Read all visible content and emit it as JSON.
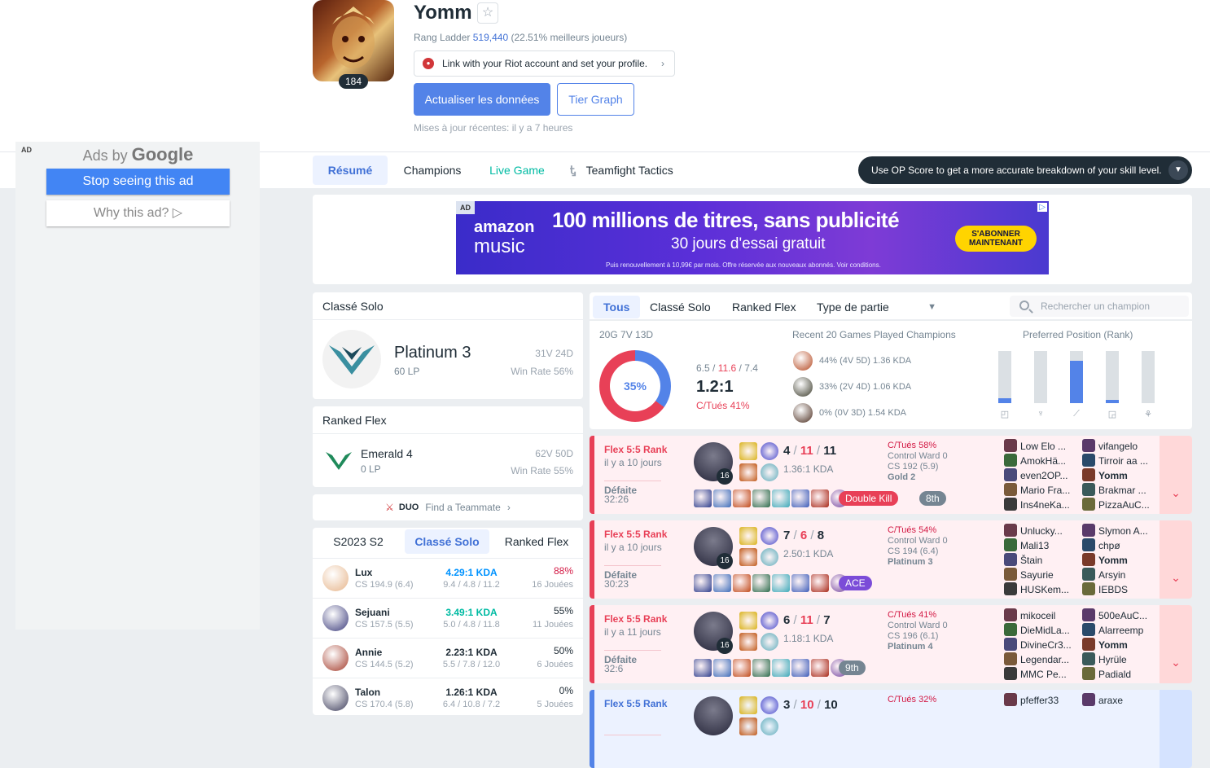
{
  "profile": {
    "name": "Yomm",
    "level": "184",
    "ladder_prefix": "Rang Ladder",
    "ladder_rank": "519,440",
    "ladder_suffix": "(22.51% meilleurs joueurs)",
    "riot_link": "Link with your Riot account and set your profile.",
    "update_button": "Actualiser les données",
    "tier_graph_button": "Tier Graph",
    "last_update": "Mises à jour récentes: il y a 7 heures"
  },
  "google_ad": {
    "label": "AD",
    "ads_by": "Ads by",
    "google": "Google",
    "stop": "Stop seeing this ad",
    "why": "Why this ad? ▷"
  },
  "nav": {
    "tabs": [
      "Résumé",
      "Champions",
      "Live Game",
      "Teamfight Tactics"
    ],
    "op_banner": "Use OP Score to get a more accurate breakdown of your skill level."
  },
  "banner_ad": {
    "label": "AD",
    "brand_top": "amazon",
    "brand_bottom": "music",
    "headline": "100 millions de titres, sans publicité",
    "sub": "30 jours d'essai gratuit",
    "fine": "Puis renouvellement à 10,99€ par mois. Offre réservée aux nouveaux abonnés. Voir conditions.",
    "cta_line1": "S'ABONNER",
    "cta_line2": "MAINTENANT"
  },
  "ranked_solo": {
    "title": "Classé Solo",
    "tier": "Platinum 3",
    "lp": "60 LP",
    "record": "31V 24D",
    "winrate": "Win Rate 56%"
  },
  "ranked_flex": {
    "title": "Ranked Flex",
    "tier": "Emerald 4",
    "lp": "0 LP",
    "record": "62V 50D",
    "winrate": "Win Rate 55%"
  },
  "duo": {
    "tag": "DUO",
    "text": "Find a Teammate"
  },
  "champ_stats": {
    "tabs": [
      "S2023 S2",
      "Classé Solo",
      "Ranked Flex"
    ],
    "rows": [
      {
        "name": "Lux",
        "cs": "CS 194.9 (6.4)",
        "kda": "4.29:1 KDA",
        "kda_detail": "9.4 / 4.8 / 11.2",
        "wr": "88%",
        "games": "16 Jouées",
        "kda_color": "#0093ff",
        "wr_color": "#d31a45",
        "avatar": "#e6b48a"
      },
      {
        "name": "Sejuani",
        "cs": "CS 157.5 (5.5)",
        "kda": "3.49:1 KDA",
        "kda_detail": "5.0 / 4.8 / 11.8",
        "wr": "55%",
        "games": "11 Jouées",
        "kda_color": "#00bba3",
        "wr_color": "#202d37",
        "avatar": "#3a3a7a"
      },
      {
        "name": "Annie",
        "cs": "CS 144.5 (5.2)",
        "kda": "2.23:1 KDA",
        "kda_detail": "5.5 / 7.8 / 12.0",
        "wr": "50%",
        "games": "6 Jouées",
        "kda_color": "#202d37",
        "wr_color": "#202d37",
        "avatar": "#a33a2a"
      },
      {
        "name": "Talon",
        "cs": "CS 170.4 (5.8)",
        "kda": "1.26:1 KDA",
        "kda_detail": "6.4 / 10.8 / 7.2",
        "wr": "0%",
        "games": "5 Jouées",
        "kda_color": "#202d37",
        "wr_color": "#202d37",
        "avatar": "#3c3c5a"
      }
    ]
  },
  "filters": {
    "tabs": [
      "Tous",
      "Classé Solo",
      "Ranked Flex",
      "Type de partie"
    ],
    "search_placeholder": "Rechercher un champion"
  },
  "summary": {
    "record": "20G 7V 13D",
    "winrate": "35%",
    "kda_k": "6.5",
    "kda_d": "11.6",
    "kda_a": "7.4",
    "ratio": "1.2:1",
    "kp": "C/Tués 41%",
    "recent_title": "Recent 20 Games Played Champions",
    "recent": [
      {
        "text": "44% (4V 5D) 1.36 KDA",
        "avatar": "#b4461e"
      },
      {
        "text": "33% (2V 4D) 1.06 KDA",
        "avatar": "#3a3a2a"
      },
      {
        "text": "0% (0V 3D) 1.54 KDA",
        "avatar": "#4a2c1e"
      }
    ],
    "position_title": "Preferred Position (Rank)",
    "positions": [
      {
        "name": "top",
        "fill": 0.1,
        "icon": "top-lane-icon"
      },
      {
        "name": "jungle",
        "fill": 0.0,
        "icon": "jungle-icon"
      },
      {
        "name": "mid",
        "fill": 0.82,
        "icon": "mid-lane-icon"
      },
      {
        "name": "bottom",
        "fill": 0.06,
        "icon": "bot-lane-icon"
      },
      {
        "name": "support",
        "fill": 0.0,
        "icon": "support-icon"
      }
    ]
  },
  "games": [
    {
      "type": "Flex 5:5 Rank",
      "ago": "il y a 10 jours",
      "result": "Défaite",
      "duration": "32:26",
      "level": "16",
      "k": "4",
      "d": "11",
      "a": "11",
      "kda": "1.36:1 KDA",
      "kp": "C/Tués 58%",
      "ward": "Control Ward 0",
      "cs": "CS 192 (5.9)",
      "rank": "Gold 2",
      "badges": [
        {
          "text": "Double Kill",
          "color": "#e84057"
        },
        {
          "text": "8th",
          "color": "#758592"
        }
      ],
      "team1": [
        "Low Elo ...",
        "AmokHä...",
        "even2OP...",
        "Mario Fra...",
        "Ins4neKa..."
      ],
      "team2": [
        "vifangelo",
        "Tirroir aa ...",
        "Yomm",
        "Brakmar ...",
        "PizzaAuC..."
      ]
    },
    {
      "type": "Flex 5:5 Rank",
      "ago": "il y a 10 jours",
      "result": "Défaite",
      "duration": "30:23",
      "level": "16",
      "k": "7",
      "d": "6",
      "a": "8",
      "kda": "2.50:1 KDA",
      "kp": "C/Tués 54%",
      "ward": "Control Ward 0",
      "cs": "CS 194 (6.4)",
      "rank": "Platinum 3",
      "badges": [
        {
          "text": "ACE",
          "color": "#7b4cd8"
        }
      ],
      "team1": [
        "Unlucky...",
        "Mali13",
        "Štain",
        "Sayurie",
        "HUSKem..."
      ],
      "team2": [
        "Slymon A...",
        "chpø",
        "Yomm",
        "Arsyin",
        "IEBDS"
      ]
    },
    {
      "type": "Flex 5:5 Rank",
      "ago": "il y a 11 jours",
      "result": "Défaite",
      "duration": "32:6",
      "level": "16",
      "k": "6",
      "d": "11",
      "a": "7",
      "kda": "1.18:1 KDA",
      "kp": "C/Tués 41%",
      "ward": "Control Ward 0",
      "cs": "CS 196 (6.1)",
      "rank": "Platinum 4",
      "badges": [
        {
          "text": "9th",
          "color": "#758592"
        }
      ],
      "team1": [
        "mikoceil",
        "DieMidLa...",
        "DivineCr3...",
        "Legendar...",
        "MMC Pe..."
      ],
      "team2": [
        "500eAuC...",
        "Alarreemp",
        "Yomm",
        "Hyrüle",
        "Padiald"
      ]
    },
    {
      "type": "Flex 5:5 Rank",
      "ago": "",
      "result": "",
      "duration": "",
      "level": "",
      "k": "3",
      "d": "10",
      "a": "10",
      "kda": "",
      "kp": "C/Tués 32%",
      "ward": "",
      "cs": "",
      "rank": "",
      "badges": [],
      "team1": [
        "pfeffer33"
      ],
      "team2": [
        "araxe"
      ]
    }
  ]
}
